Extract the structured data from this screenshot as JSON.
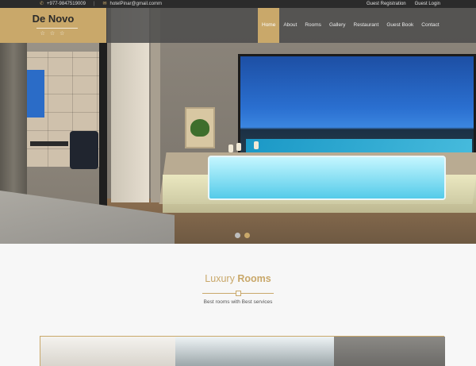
{
  "topbar": {
    "phone": "+977-9847519009",
    "email": "hotelPinar@gmail.comm",
    "separator": "|",
    "guest_registration": "Guest Registration",
    "guest_login": "Guest Login"
  },
  "brand": {
    "name": "De Novo",
    "stars": "☆ ☆ ☆"
  },
  "nav": {
    "items": [
      "Home",
      "About",
      "Rooms",
      "Gallery",
      "Restaurant",
      "Guest Book",
      "Contact"
    ],
    "active": "Home"
  },
  "slider": {
    "slide_count": 2,
    "active_index": 1
  },
  "section": {
    "title_light": "Luxury",
    "title_bold": "Rooms",
    "subtitle": "Best rooms with Best services"
  },
  "colors": {
    "accent": "#c9a86a",
    "topbar": "#2b2b2b",
    "nav_overlay": "#4b4b4b"
  }
}
